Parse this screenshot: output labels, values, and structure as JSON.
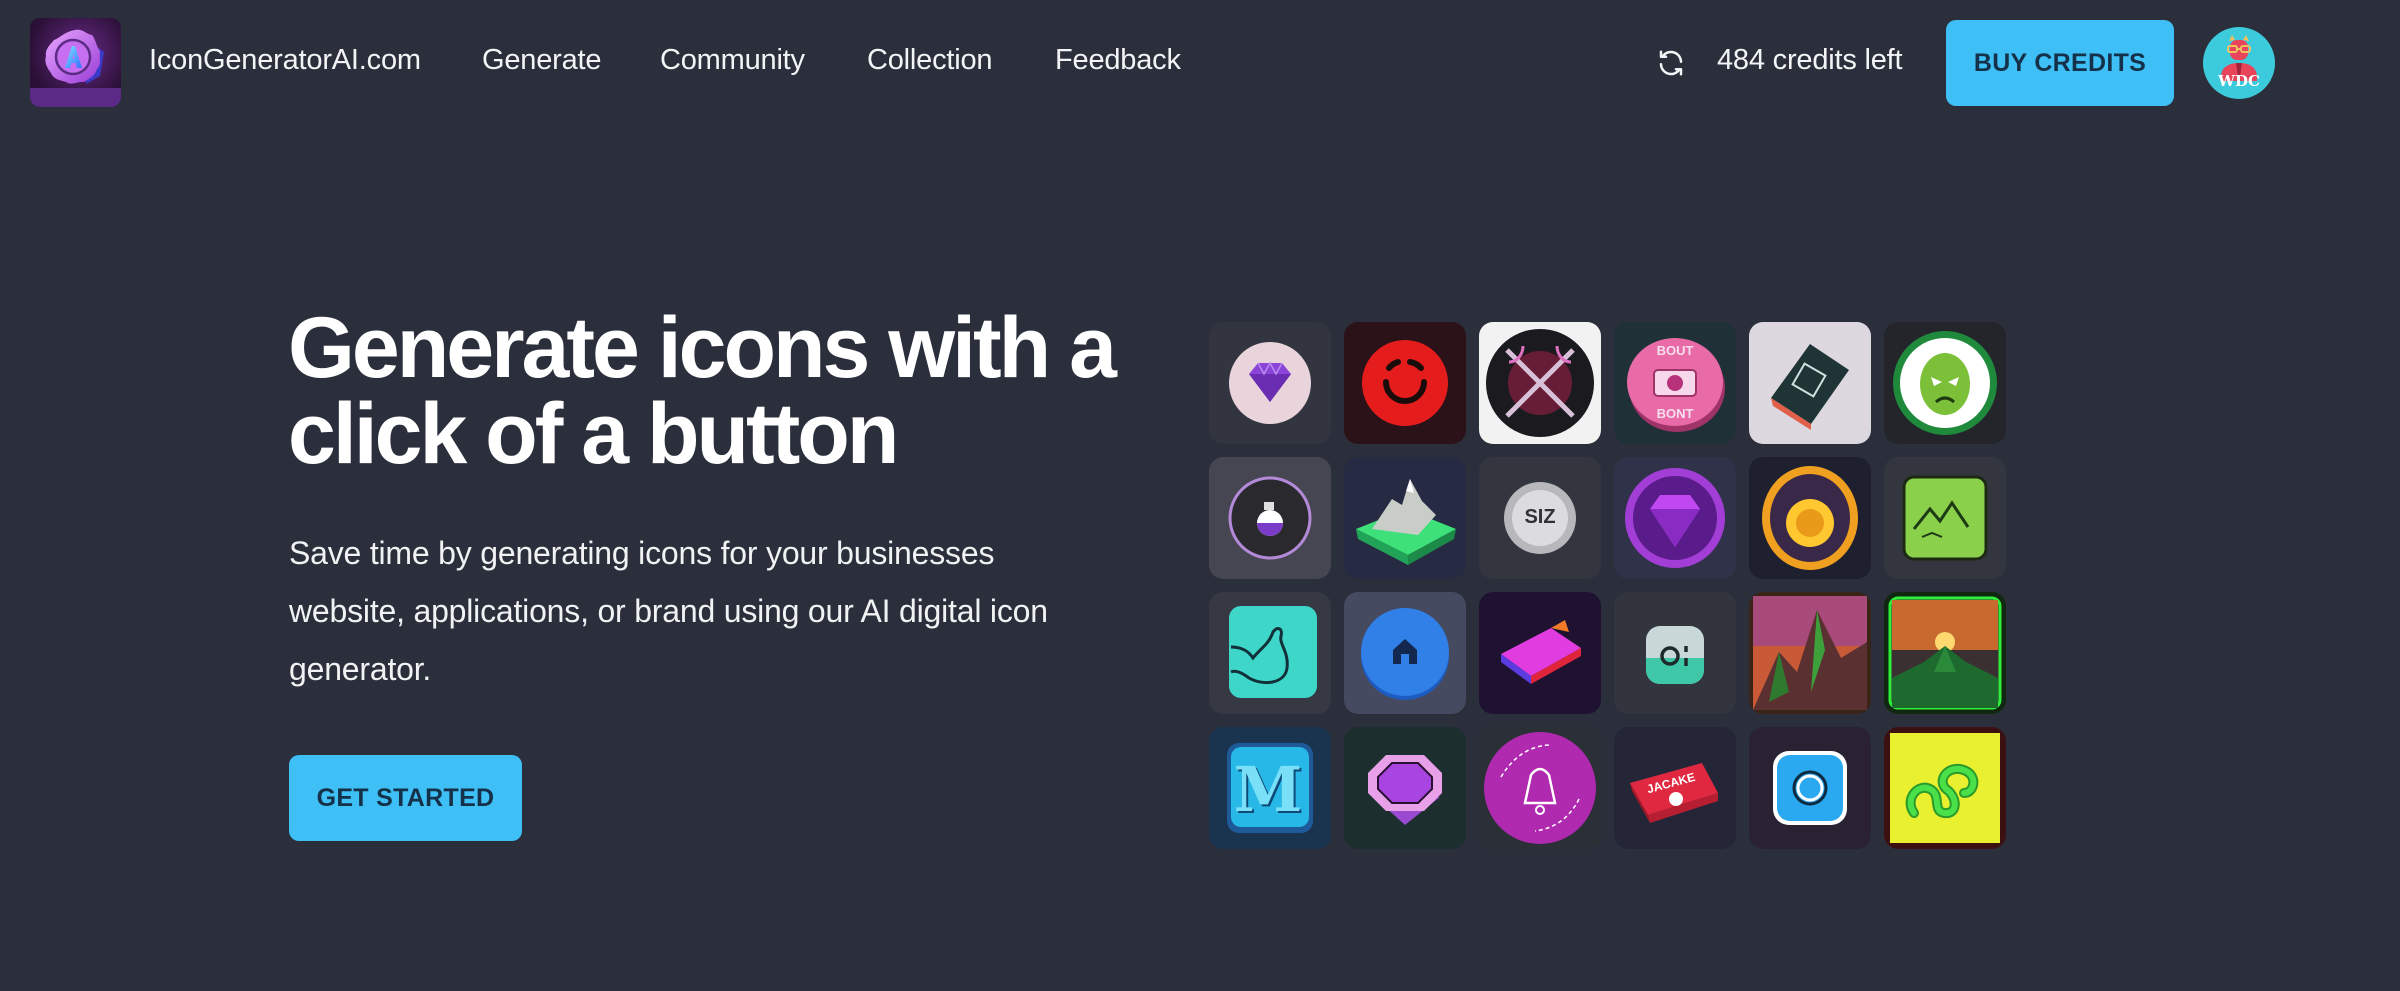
{
  "nav": {
    "brand": "IconGeneratorAI.com",
    "links": [
      "Generate",
      "Community",
      "Collection",
      "Feedback"
    ],
    "credits_text": "484 credits left",
    "buy_credits_label": "BUY CREDITS",
    "avatar_initials": "WDC",
    "icons": {
      "logo": "logo-badge-icon",
      "refresh": "refresh-icon",
      "avatar": "user-avatar"
    }
  },
  "hero": {
    "headline": "Generate icons with a click of a button",
    "subtext": "Save time by generating icons for your businesses website, applications, or brand using our AI digital icon generator.",
    "cta_label": "GET STARTED"
  },
  "gallery": {
    "icons": [
      {
        "name": "purple-gem-icon"
      },
      {
        "name": "red-circle-icon"
      },
      {
        "name": "crossed-swords-icon"
      },
      {
        "name": "pink-coin-icon",
        "text_top": "BOUT",
        "text_bottom": "BONT"
      },
      {
        "name": "dark-cube-icon"
      },
      {
        "name": "green-alien-icon"
      },
      {
        "name": "perfume-bottle-icon"
      },
      {
        "name": "snowy-mountain-block-icon"
      },
      {
        "name": "silver-badge-icon",
        "text": "SIZ"
      },
      {
        "name": "purple-gem-coin-icon"
      },
      {
        "name": "golden-coin-icon"
      },
      {
        "name": "green-landscape-icon"
      },
      {
        "name": "flexed-arm-icon"
      },
      {
        "name": "blue-home-button-icon"
      },
      {
        "name": "gradient-block-icon"
      },
      {
        "name": "camera-app-icon"
      },
      {
        "name": "mountain-painting-icon"
      },
      {
        "name": "sunset-mountain-icon"
      },
      {
        "name": "letter-m-book-icon",
        "text": "M"
      },
      {
        "name": "purple-octagon-gem-icon"
      },
      {
        "name": "magenta-bell-icon"
      },
      {
        "name": "red-jacake-box-icon",
        "text": "JACAKE"
      },
      {
        "name": "blue-lens-icon"
      },
      {
        "name": "green-snake-icon"
      }
    ]
  },
  "colors": {
    "background": "#2a2f3b",
    "accent": "#3ebff5",
    "button_text": "#15314a"
  }
}
